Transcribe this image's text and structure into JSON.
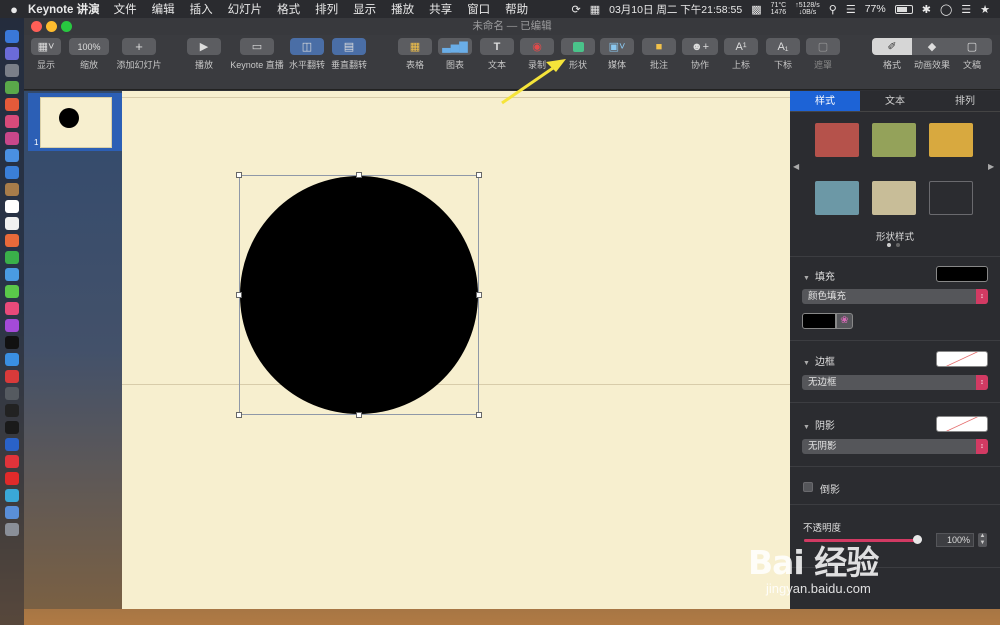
{
  "menubar": {
    "apple_icon": "apple-logo-icon",
    "app_name": "Keynote 讲演",
    "menus": [
      "文件",
      "编辑",
      "插入",
      "幻灯片",
      "格式",
      "排列",
      "显示",
      "播放",
      "共享",
      "窗口",
      "帮助"
    ],
    "datetime": "03月10日 周二 下午21:58:55",
    "temp": "71°C",
    "fan": "1476",
    "net_up": "↑5128/s",
    "net_down": "↓0B/s",
    "battery": "77%",
    "battery_level": 0.77
  },
  "window": {
    "title": "未命名 — 已编辑"
  },
  "toolbar": {
    "view": "显示",
    "zoom_value": "100%",
    "zoom": "缩放",
    "add_slide": "添加幻灯片",
    "play": "播放",
    "keynote_live": "Keynote 直播",
    "flip_h": "水平翻转",
    "flip_v": "垂直翻转",
    "table": "表格",
    "chart": "图表",
    "text": "文本",
    "record": "录制",
    "shape": "形状",
    "media": "媒体",
    "comment": "批注",
    "collaborate": "协作",
    "superscript": "上标",
    "subscript": "下标",
    "mask": "遮罩",
    "format": "格式",
    "animate": "动画效果",
    "document": "文稿"
  },
  "navigator": {
    "slide_number": "1"
  },
  "inspector": {
    "tabs": [
      "样式",
      "文本",
      "排列"
    ],
    "styles_label": "形状样式",
    "style_colors": [
      "#b5524b",
      "#94a25a",
      "#d8a93f",
      "#6c98a6",
      "#c8bd98",
      "#2b2c30"
    ],
    "fill": {
      "title": "填充",
      "type": "颜色填充",
      "color": "#000000"
    },
    "border": {
      "title": "边框",
      "type": "无边框"
    },
    "shadow": {
      "title": "阴影",
      "type": "无阴影"
    },
    "reflection": "倒影",
    "opacity": {
      "title": "不透明度",
      "value": "100%",
      "level": 1.0
    }
  },
  "watermark": {
    "brand": "Bai 经验",
    "url": "jingyan.baidu.com"
  }
}
